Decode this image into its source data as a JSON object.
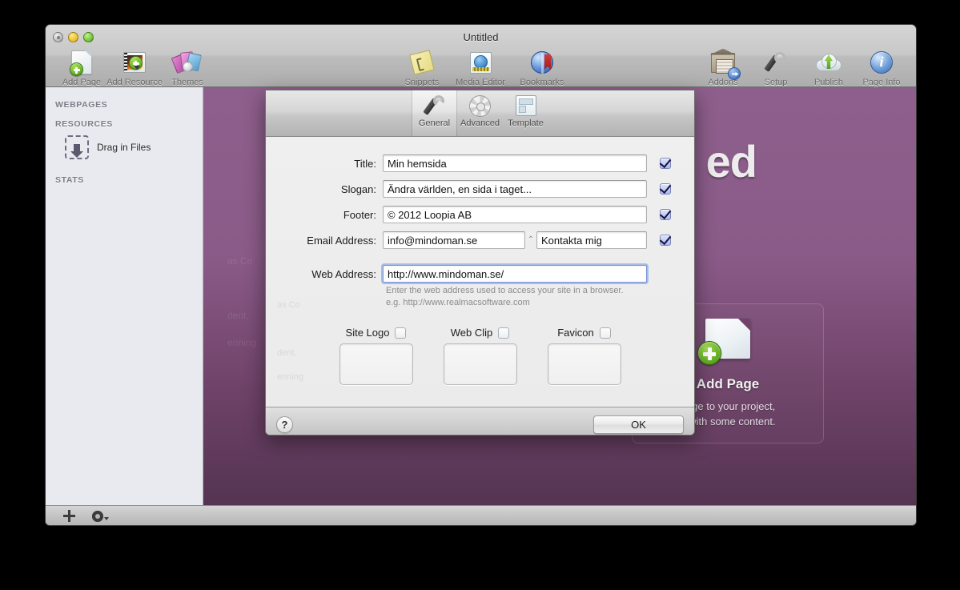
{
  "window": {
    "title": "Untitled",
    "controls": {
      "close": "close-button",
      "minimize": "minimize-button",
      "zoom": "zoom-button"
    }
  },
  "toolbar": {
    "left": [
      {
        "label": "Add Page",
        "icon": "add-page-icon"
      },
      {
        "label": "Add Resource",
        "icon": "add-resource-icon"
      },
      {
        "label": "Themes",
        "icon": "themes-icon"
      }
    ],
    "center": [
      {
        "label": "Snippets",
        "icon": "snippets-icon"
      },
      {
        "label": "Media Editor",
        "icon": "media-editor-icon"
      },
      {
        "label": "Bookmarks",
        "icon": "bookmarks-icon"
      }
    ],
    "right": [
      {
        "label": "Addons",
        "icon": "addons-icon"
      },
      {
        "label": "Setup",
        "icon": "setup-icon"
      },
      {
        "label": "Publish",
        "icon": "publish-icon"
      },
      {
        "label": "Page Info",
        "icon": "page-info-icon"
      }
    ]
  },
  "sidebar": {
    "sections": [
      {
        "label": "WEBPAGES"
      },
      {
        "label": "RESOURCES"
      },
      {
        "label": "STATS"
      }
    ],
    "drop_label": "Drag in Files"
  },
  "canvas": {
    "heading": "ed",
    "ghost_text": "as Co\n\ndent,\nenning",
    "add_page_card": {
      "title": "Add Page",
      "description_line1": "page to your project,",
      "description_line2": "g with some content."
    }
  },
  "bottom_bar": {
    "add": "add-button",
    "settings": "settings-gear-button"
  },
  "sheet": {
    "tabs": [
      {
        "label": "General",
        "icon": "wrench-icon",
        "selected": true
      },
      {
        "label": "Advanced",
        "icon": "gear-icon",
        "selected": false
      },
      {
        "label": "Template",
        "icon": "template-icon",
        "selected": false
      }
    ],
    "ghost_text": "as Co\n\ndent,\nenning",
    "fields": [
      {
        "label": "Title:",
        "value": "Min hemsida",
        "checkbox": true,
        "focused": false
      },
      {
        "label": "Slogan:",
        "value": "Ändra världen, en sida i taget...",
        "checkbox": true,
        "focused": false
      },
      {
        "label": "Footer:",
        "value": "© 2012 Loopia AB",
        "checkbox": true,
        "focused": false
      }
    ],
    "email": {
      "label": "Email Address:",
      "address_value": "info@mindoman.se",
      "separator": "⌃",
      "link_value": "Kontakta mig",
      "checkbox": true
    },
    "web_address": {
      "label": "Web Address:",
      "value": "http://www.mindoman.se/",
      "focused": true,
      "hint_line1": "Enter the web address used to access your site in a browser.",
      "hint_line2": "e.g. http://www.realmacsoftware.com"
    },
    "media": [
      {
        "label": "Site Logo",
        "checked": false
      },
      {
        "label": "Web Clip",
        "checked": false
      },
      {
        "label": "Favicon",
        "checked": false
      }
    ],
    "footer": {
      "help_label": "?",
      "ok_label": "OK"
    }
  },
  "colors": {
    "canvas_purple_top": "#8e5f8c",
    "canvas_purple_bottom": "#543351",
    "checkbox_blue": "#a8b8ee",
    "focus_ring": "#7d97d8"
  }
}
